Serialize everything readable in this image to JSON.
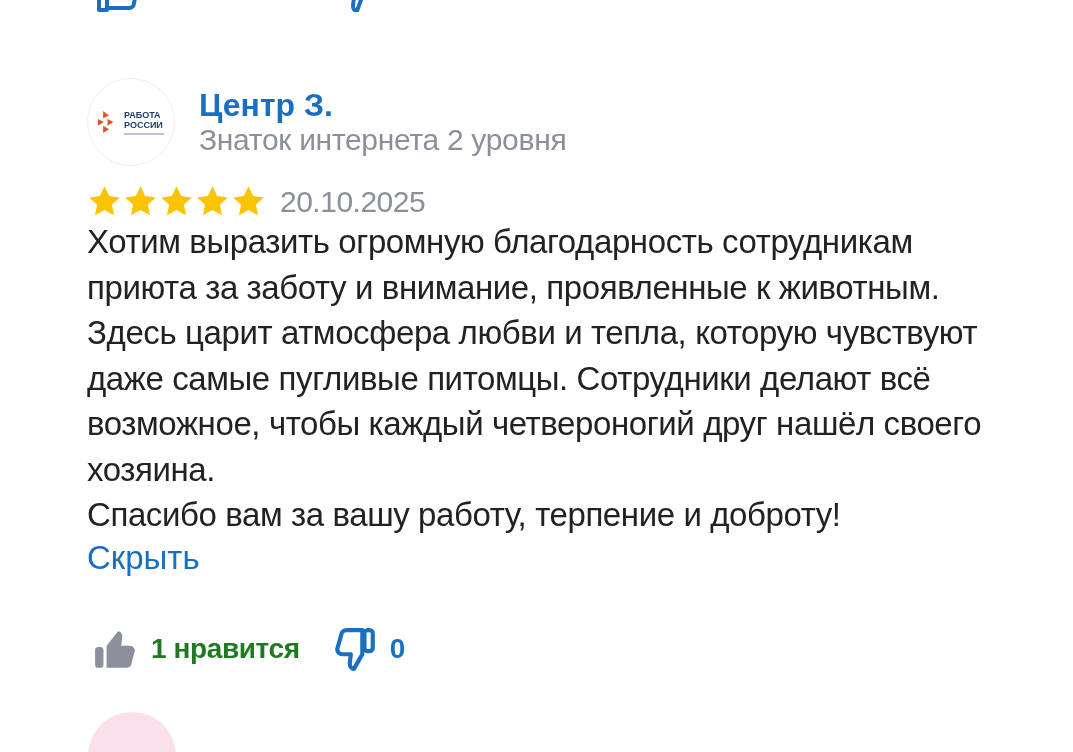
{
  "review": {
    "author": {
      "name": "Центр З.",
      "level": "Знаток интернета 2 уровня",
      "avatar": {
        "line_1": "РАБОТА",
        "line_2": "РОССИИ"
      }
    },
    "stars": 5,
    "date": "20.10.2025",
    "paragraphs": [
      "Хотим выразить огромную благодарность сотрудникам приюта за заботу и внимание, проявленные к животным. Здесь царит атмосфера любви и тепла, которую чувствуют даже самые пугливые питомцы. Сотрудники делают всё возможное, чтобы каждый четвероногий друг нашёл своего хозяина.",
      "Спасибо вам за вашу работу, терпение и доброту!"
    ],
    "collapse_link": "Скрыть",
    "likes": {
      "label": "1 нравится"
    },
    "dislikes": {
      "count": "0"
    }
  }
}
